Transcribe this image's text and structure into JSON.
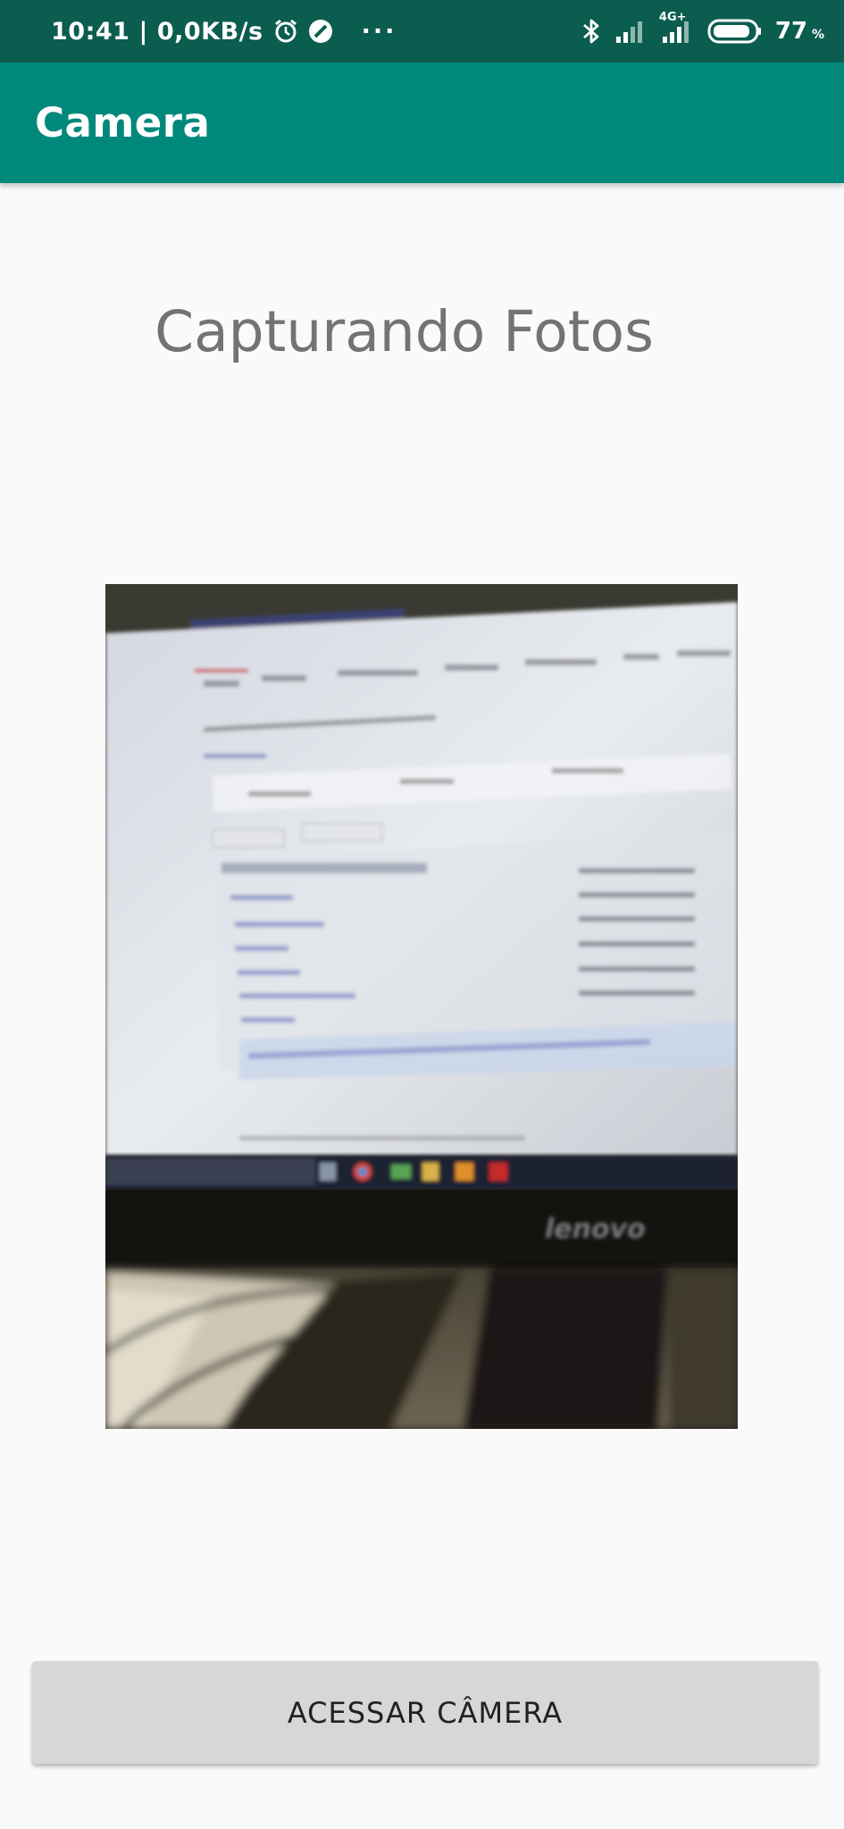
{
  "status_bar": {
    "time": "10:41",
    "network_speed": "0,0KB/s",
    "alarm_icon": "alarm-clock-icon",
    "dnd_icon": "do-not-disturb-icon",
    "more": "···",
    "bluetooth_icon": "bluetooth-icon",
    "network_type": "4G+",
    "battery": "77"
  },
  "app_bar": {
    "title": "Camera",
    "color": "#00897b"
  },
  "main": {
    "heading": "Capturando Fotos",
    "photo": {
      "brand_text": "lenovo"
    },
    "button_label": "ACESSAR CÂMERA"
  }
}
